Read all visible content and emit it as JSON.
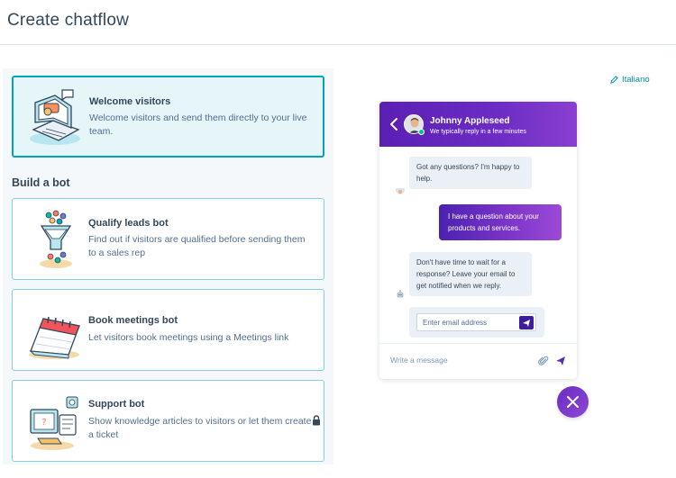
{
  "header": {
    "title": "Create chatflow"
  },
  "welcome_card": {
    "title": "Welcome visitors",
    "description": "Welcome visitors and send them directly to your live team.",
    "icon": "laptop-chat-illustration"
  },
  "bots_section": {
    "title": "Build a bot",
    "cards": [
      {
        "title": "Qualify leads bot",
        "description": "Find out if visitors are qualified before sending them to a sales rep",
        "icon": "funnel-illustration"
      },
      {
        "title": "Book meetings bot",
        "description": "Let visitors book meetings using a Meetings link",
        "icon": "calendar-illustration"
      },
      {
        "title": "Support bot",
        "description": "Show knowledge articles to visitors or let them create a ticket",
        "icon": "support-illustration",
        "locked": true
      }
    ]
  },
  "language_link": {
    "label": "Italiano",
    "icon": "pencil-icon"
  },
  "chat_preview": {
    "agent_name": "Johnny Appleseed",
    "agent_status": "We typically reply in a few minutes",
    "messages": [
      {
        "from": "bot",
        "text": "Got any questions? I'm happy to help."
      },
      {
        "from": "user",
        "text": "I have a question about your products and services."
      },
      {
        "from": "bot",
        "text": "Don't have time to wait for a response? Leave your email to get notified when we reply."
      }
    ],
    "email_placeholder": "Enter email address",
    "message_placeholder": "Write a message"
  },
  "colors": {
    "accent_teal": "#00a4bd",
    "widget_purple": "#5b1fb4",
    "text_dark": "#33475b"
  }
}
